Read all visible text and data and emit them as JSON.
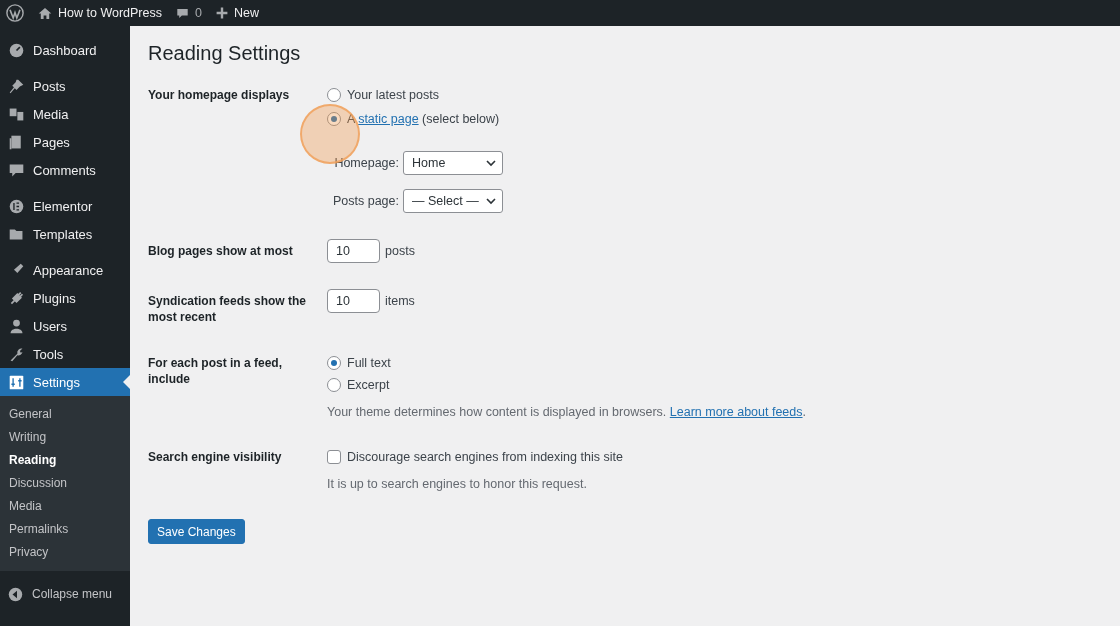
{
  "admin_bar": {
    "site_name": "How to WordPress",
    "comments_count": "0",
    "new_label": "New"
  },
  "sidebar": {
    "groups": [
      [
        {
          "label": "Dashboard",
          "selected": false
        }
      ],
      [
        {
          "label": "Posts",
          "selected": false
        },
        {
          "label": "Media",
          "selected": false
        },
        {
          "label": "Pages",
          "selected": false
        },
        {
          "label": "Comments",
          "selected": false
        }
      ],
      [
        {
          "label": "Elementor",
          "selected": false
        },
        {
          "label": "Templates",
          "selected": false
        }
      ],
      [
        {
          "label": "Appearance",
          "selected": false
        },
        {
          "label": "Plugins",
          "selected": false
        },
        {
          "label": "Users",
          "selected": false
        },
        {
          "label": "Tools",
          "selected": false
        },
        {
          "label": "Settings",
          "selected": true,
          "children": [
            {
              "label": "General",
              "selected": false
            },
            {
              "label": "Writing",
              "selected": false
            },
            {
              "label": "Reading",
              "selected": true
            },
            {
              "label": "Discussion",
              "selected": false
            },
            {
              "label": "Media",
              "selected": false
            },
            {
              "label": "Permalinks",
              "selected": false
            },
            {
              "label": "Privacy",
              "selected": false
            }
          ]
        }
      ]
    ],
    "collapse_label": "Collapse menu"
  },
  "page": {
    "title": "Reading Settings",
    "homepage_displays": {
      "label": "Your homepage displays",
      "options": [
        {
          "label": "Your latest posts",
          "selected": false
        },
        {
          "label_prefix": "A",
          "link": "static page",
          "label_suffix": "(select below)",
          "selected": true
        }
      ],
      "selects": [
        {
          "label": "Homepage:",
          "value": "Home"
        },
        {
          "label": "Posts page:",
          "value": "— Select —"
        }
      ]
    },
    "blog_pages": {
      "label": "Blog pages show at most",
      "value": "10",
      "unit": "posts"
    },
    "syndication": {
      "label": "Syndication feeds show the most recent",
      "value": "10",
      "unit": "items"
    },
    "feed_include": {
      "label": "For each post in a feed, include",
      "options": [
        {
          "label": "Full text",
          "selected": true
        },
        {
          "label": "Excerpt",
          "selected": false
        }
      ],
      "description": "Your theme determines how content is displayed in browsers.",
      "link": "Learn more about feeds",
      "suffix": "."
    },
    "search_visibility": {
      "label": "Search engine visibility",
      "checkbox_label": "Discourage search engines from indexing this site",
      "checked": false,
      "description": "It is up to search engines to honor this request."
    },
    "save_button": "Save Changes"
  }
}
